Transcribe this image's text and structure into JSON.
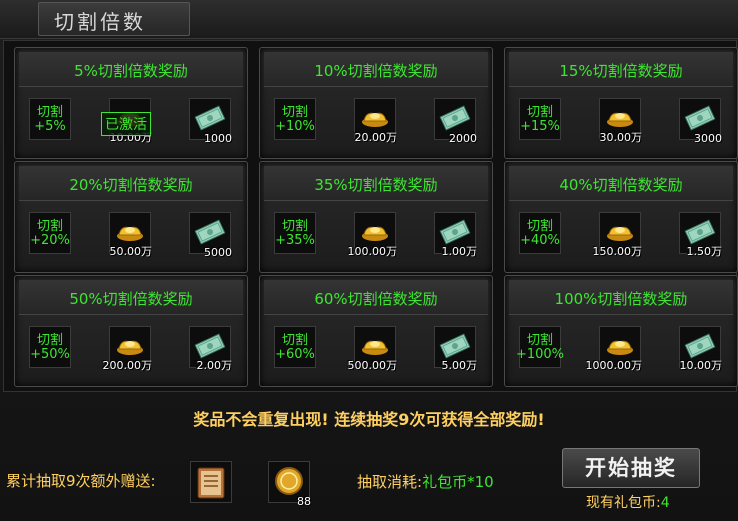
{
  "window": {
    "title": "切割倍数"
  },
  "cards": [
    {
      "title": "5%切割倍数奖励",
      "rate_line1": "切割",
      "rate_line2": "+5%",
      "gold_qty": "10.00万",
      "bill_qty": "1000",
      "status": "已激活"
    },
    {
      "title": "10%切割倍数奖励",
      "rate_line1": "切割",
      "rate_line2": "+10%",
      "gold_qty": "20.00万",
      "bill_qty": "2000"
    },
    {
      "title": "15%切割倍数奖励",
      "rate_line1": "切割",
      "rate_line2": "+15%",
      "gold_qty": "30.00万",
      "bill_qty": "3000"
    },
    {
      "title": "20%切割倍数奖励",
      "rate_line1": "切割",
      "rate_line2": "+20%",
      "gold_qty": "50.00万",
      "bill_qty": "5000"
    },
    {
      "title": "35%切割倍数奖励",
      "rate_line1": "切割",
      "rate_line2": "+35%",
      "gold_qty": "100.00万",
      "bill_qty": "1.00万"
    },
    {
      "title": "40%切割倍数奖励",
      "rate_line1": "切割",
      "rate_line2": "+40%",
      "gold_qty": "150.00万",
      "bill_qty": "1.50万"
    },
    {
      "title": "50%切割倍数奖励",
      "rate_line1": "切割",
      "rate_line2": "+50%",
      "gold_qty": "200.00万",
      "bill_qty": "2.00万"
    },
    {
      "title": "60%切割倍数奖励",
      "rate_line1": "切割",
      "rate_line2": "+60%",
      "gold_qty": "500.00万",
      "bill_qty": "5.00万"
    },
    {
      "title": "100%切割倍数奖励",
      "rate_line1": "切割",
      "rate_line2": "+100%",
      "gold_qty": "1000.00万",
      "bill_qty": "10.00万"
    }
  ],
  "notice": "奖品不会重复出现!  连续抽奖9次可获得全部奖励!",
  "bonus": {
    "label": "累计抽取9次额外赠送:",
    "coin_qty": "88"
  },
  "cost": {
    "label": "抽取消耗:",
    "value": "礼包币*10"
  },
  "start_button": "开始抽奖",
  "balance": {
    "label": "现有礼包币:",
    "value": "4"
  },
  "icons": {
    "gold": "gold-ingot-icon",
    "bill": "banknote-icon",
    "book": "book-icon",
    "coin": "gold-coin-icon"
  },
  "colors": {
    "green_text": "#3ee632",
    "gold_text": "#ffd060"
  }
}
